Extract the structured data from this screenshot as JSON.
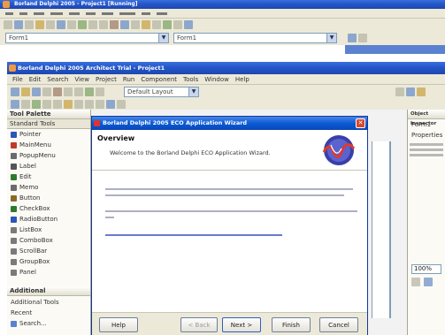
{
  "outer_window": {
    "title": "Borland Delphi 2005 - Project1 [Running]"
  },
  "outer_combos": {
    "left": "Form1",
    "right": "Form1"
  },
  "inner_window": {
    "title": "Borland Delphi 2005 Architect Trial - Project1",
    "menu": [
      "File",
      "Edit",
      "Search",
      "View",
      "Project",
      "Run",
      "Component",
      "Tools",
      "Window",
      "Help"
    ],
    "layout_combo": "Default Layout"
  },
  "tool_palette": {
    "title": "Tool Palette",
    "category": "Standard Tools",
    "items": [
      {
        "label": "Pointer",
        "color": "#2b55b8"
      },
      {
        "label": "MainMenu",
        "color": "#c0392b"
      },
      {
        "label": "PopupMenu",
        "color": "#6b6b6b"
      },
      {
        "label": "Label",
        "color": "#555555"
      },
      {
        "label": "Edit",
        "color": "#2d7a2d"
      },
      {
        "label": "Memo",
        "color": "#6b6b6b"
      },
      {
        "label": "Button",
        "color": "#8a6a2a"
      },
      {
        "label": "CheckBox",
        "color": "#2d7a2d"
      },
      {
        "label": "RadioButton",
        "color": "#2b55b8"
      },
      {
        "label": "ListBox",
        "color": "#7a7a7a"
      },
      {
        "label": "ComboBox",
        "color": "#7a7a7a"
      },
      {
        "label": "ScrollBar",
        "color": "#7a7a7a"
      },
      {
        "label": "GroupBox",
        "color": "#7a7a7a"
      },
      {
        "label": "Panel",
        "color": "#7a7a7a"
      }
    ],
    "bottom_header": "Additional",
    "bottom_items": [
      "Additional Tools",
      "Recent",
      "Search..."
    ]
  },
  "dialog": {
    "title": "Borland Delphi 2005 ECO Application Wizard",
    "section_title": "Overview",
    "section_subtitle": "Welcome to the Borland Delphi ECO Application Wizard.",
    "buttons": {
      "help": "Help",
      "back": "< Back",
      "next": "Next >",
      "finish": "Finish",
      "cancel": "Cancel"
    }
  },
  "right_panel": {
    "title": "Object Inspector",
    "items": [
      "Form1",
      "Properties"
    ],
    "prop_label": "100%"
  },
  "colors": {
    "xp_blue": "#2456c9",
    "dialog_title": "#0b5bd6",
    "link_blue": "#2a45b0"
  }
}
